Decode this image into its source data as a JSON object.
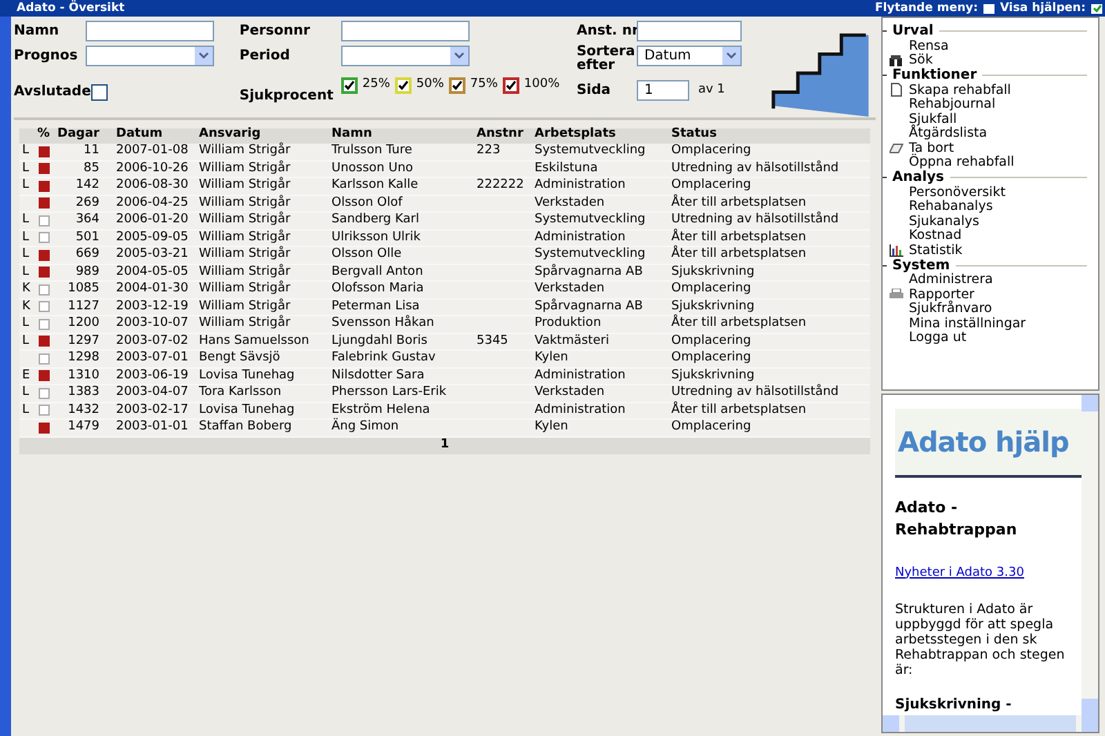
{
  "window": {
    "title": "Adato - Översikt"
  },
  "top_options": [
    {
      "label": "Flytande meny:",
      "checked": false
    },
    {
      "label": "Visa hjälpen:",
      "checked": true
    }
  ],
  "filters": {
    "namn": {
      "label": "Namn"
    },
    "personnr": {
      "label": "Personnr"
    },
    "anstnr": {
      "label": "Anst. nr"
    },
    "prognos": {
      "label": "Prognos"
    },
    "period": {
      "label": "Period"
    },
    "sortera": {
      "label": "Sortera efter",
      "value": "Datum"
    },
    "avslutade": {
      "label": "Avslutade",
      "checked": false
    },
    "sjukprocent": {
      "label": "Sjukprocent",
      "options": [
        {
          "label": "25%",
          "checked": true,
          "color": "#3aa63a"
        },
        {
          "label": "50%",
          "checked": true,
          "color": "#d8d83a"
        },
        {
          "label": "75%",
          "checked": true,
          "color": "#b88a3a"
        },
        {
          "label": "100%",
          "checked": true,
          "color": "#c02a2a"
        }
      ]
    },
    "sida": {
      "label": "Sida",
      "value": "1",
      "total": "av 1"
    }
  },
  "table": {
    "columns": [
      "%",
      "Dagar",
      "Datum",
      "Ansvarig",
      "Namn",
      "Anstnr",
      "Arbetsplats",
      "Status"
    ],
    "rows": [
      {
        "marked": true,
        "cells": [
          "L",
          "11",
          "2007-01-08",
          "William Strigår",
          "Trulsson Ture",
          "223",
          "Systemutveckling",
          "Omplacering"
        ]
      },
      {
        "marked": true,
        "cells": [
          "L",
          "85",
          "2006-10-26",
          "William Strigår",
          "Unosson Uno",
          "",
          "Eskilstuna",
          "Utredning av hälsotillstånd"
        ]
      },
      {
        "marked": true,
        "cells": [
          "L",
          "142",
          "2006-08-30",
          "William Strigår",
          "Karlsson Kalle",
          "222222",
          "Administration",
          "Omplacering"
        ]
      },
      {
        "marked": true,
        "cells": [
          "",
          "269",
          "2006-04-25",
          "William Strigår",
          "Olsson Olof",
          "",
          "Verkstaden",
          "Åter till arbetsplatsen"
        ]
      },
      {
        "marked": false,
        "cells": [
          "L",
          "364",
          "2006-01-20",
          "William Strigår",
          "Sandberg Karl",
          "",
          "Systemutveckling",
          "Utredning av hälsotillstånd"
        ]
      },
      {
        "marked": false,
        "cells": [
          "L",
          "501",
          "2005-09-05",
          "William Strigår",
          "Ulriksson Ulrik",
          "",
          "Administration",
          "Åter till arbetsplatsen"
        ]
      },
      {
        "marked": true,
        "cells": [
          "L",
          "669",
          "2005-03-21",
          "William Strigår",
          "Olsson Olle",
          "",
          "Systemutveckling",
          "Åter till arbetsplatsen"
        ]
      },
      {
        "marked": true,
        "cells": [
          "L",
          "989",
          "2004-05-05",
          "William Strigår",
          "Bergvall Anton",
          "",
          "Spårvagnarna AB",
          "Sjukskrivning"
        ]
      },
      {
        "marked": false,
        "cells": [
          "K",
          "1085",
          "2004-01-30",
          "William Strigår",
          "Olofsson Maria",
          "",
          "Verkstaden",
          "Omplacering"
        ]
      },
      {
        "marked": false,
        "cells": [
          "K",
          "1127",
          "2003-12-19",
          "William Strigår",
          "Peterman Lisa",
          "",
          "Spårvagnarna AB",
          "Sjukskrivning"
        ]
      },
      {
        "marked": false,
        "cells": [
          "L",
          "1200",
          "2003-10-07",
          "William Strigår",
          "Svensson Håkan",
          "",
          "Produktion",
          "Åter till arbetsplatsen"
        ]
      },
      {
        "marked": true,
        "cells": [
          "L",
          "1297",
          "2003-07-02",
          "Hans Samuelsson",
          "Ljungdahl Boris",
          "5345",
          "Vaktmästeri",
          "Omplacering"
        ]
      },
      {
        "marked": false,
        "cells": [
          "",
          "1298",
          "2003-07-01",
          "Bengt Sävsjö",
          "Falebrink Gustav",
          "",
          "Kylen",
          "Omplacering"
        ]
      },
      {
        "marked": true,
        "cells": [
          "E",
          "1310",
          "2003-06-19",
          "Lovisa Tunehag",
          "Nilsdotter Sara",
          "",
          "Administration",
          "Sjukskrivning"
        ]
      },
      {
        "marked": false,
        "cells": [
          "L",
          "1383",
          "2003-04-07",
          "Tora Karlsson",
          "Phersson Lars-Erik",
          "",
          "Verkstaden",
          "Utredning av hälsotillstånd"
        ]
      },
      {
        "marked": false,
        "cells": [
          "L",
          "1432",
          "2003-02-17",
          "Lovisa Tunehag",
          "Ekström Helena",
          "",
          "Administration",
          "Åter till arbetsplatsen"
        ]
      },
      {
        "marked": true,
        "cells": [
          "",
          "1479",
          "2003-01-01",
          "Staffan Boberg",
          "Äng Simon",
          "",
          "Kylen",
          "Omplacering"
        ]
      }
    ],
    "pager": "1"
  },
  "menu": [
    {
      "title": "Urval",
      "items": [
        {
          "label": "Rensa",
          "kind": "plain"
        },
        {
          "label": "Sök",
          "kind": "search"
        }
      ]
    },
    {
      "title": "Funktioner",
      "items": [
        {
          "label": "Skapa rehabfall",
          "kind": "create"
        },
        {
          "label": "Rehabjournal",
          "kind": "plain"
        },
        {
          "label": "Sjukfall",
          "kind": "plain"
        },
        {
          "label": "Åtgärdslista",
          "kind": "plain"
        },
        {
          "label": "Ta bort",
          "kind": "delete"
        },
        {
          "label": "Öppna rehabfall",
          "kind": "plain"
        }
      ]
    },
    {
      "title": "Analys",
      "items": [
        {
          "label": "Personöversikt",
          "kind": "plain"
        },
        {
          "label": "Rehabanalys",
          "kind": "plain"
        },
        {
          "label": "Sjukanalys",
          "kind": "plain"
        },
        {
          "label": "Kostnad",
          "kind": "plain"
        },
        {
          "label": "Statistik",
          "kind": "statistics"
        }
      ]
    },
    {
      "title": "System",
      "items": [
        {
          "label": "Administrera",
          "kind": "plain"
        },
        {
          "label": "Rapporter",
          "kind": "print"
        },
        {
          "label": "Sjukfrånvaro",
          "kind": "plain"
        },
        {
          "label": "Mina inställningar",
          "kind": "plain"
        },
        {
          "label": "Logga ut",
          "kind": "plain"
        }
      ]
    }
  ],
  "help": {
    "logo": "Adato hjälp",
    "heading": "Adato - Rehabtrappan",
    "link": "Nyheter i Adato 3.30",
    "text": "Strukturen i Adato är uppbyggd för att spegla arbetsstegen i den sk Rehabtrappan och stegen är:",
    "subheading": "Sjukskrivning -"
  }
}
